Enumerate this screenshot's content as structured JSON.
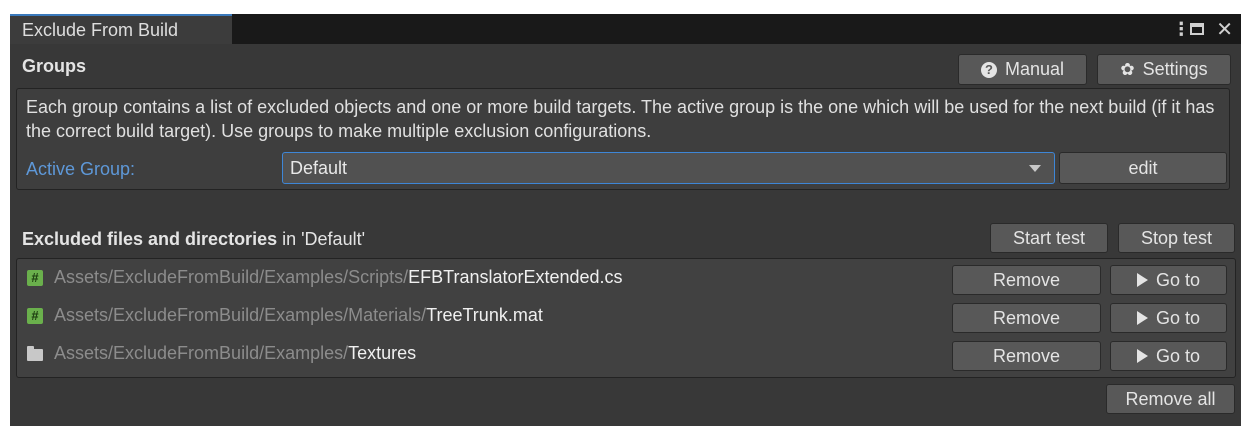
{
  "window": {
    "tab_title": "Exclude From Build"
  },
  "header": {
    "groups_title": "Groups",
    "manual_label": "Manual",
    "settings_label": "Settings"
  },
  "info": {
    "description": "Each group contains a list of excluded objects and one or more build targets. The active group is the one which will be used for the next build (if it has the correct build target). Use groups to make multiple exclusion configurations.",
    "active_group_label": "Active Group:",
    "active_group_value": "Default",
    "edit_label": "edit"
  },
  "excluded": {
    "title_bold": "Excluded files and directories",
    "title_suffix": " in 'Default'",
    "start_test_label": "Start test",
    "stop_test_label": "Stop test",
    "remove_all_label": "Remove all",
    "items": [
      {
        "icon": "csharp-script-icon",
        "dir": "Assets/ExcludeFromBuild/Examples/Scripts/",
        "name": "EFBTranslatorExtended.cs",
        "remove_label": "Remove",
        "goto_label": "Go to"
      },
      {
        "icon": "csharp-script-icon",
        "dir": "Assets/ExcludeFromBuild/Examples/Materials/",
        "name": "TreeTrunk.mat",
        "remove_label": "Remove",
        "goto_label": "Go to"
      },
      {
        "icon": "folder-icon",
        "dir": "Assets/ExcludeFromBuild/Examples/",
        "name": "Textures",
        "remove_label": "Remove",
        "goto_label": "Go to"
      }
    ]
  },
  "colors": {
    "background": "#383838",
    "accent": "#3a79bb",
    "label_blue": "#5e98d8",
    "button": "#585858"
  }
}
